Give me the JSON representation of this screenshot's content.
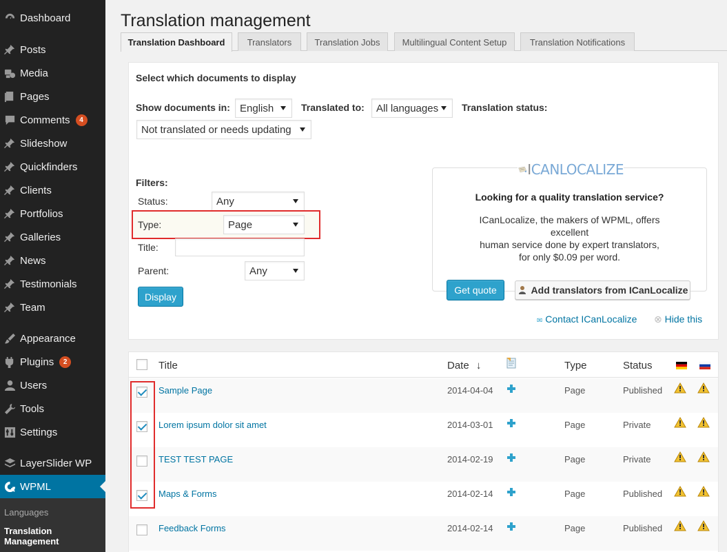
{
  "sidebar": {
    "items": [
      {
        "label": "Dashboard",
        "icon": "dashboard-icon"
      },
      {
        "label": "Posts",
        "icon": "pin-icon"
      },
      {
        "label": "Media",
        "icon": "media-icon"
      },
      {
        "label": "Pages",
        "icon": "pages-icon"
      },
      {
        "label": "Comments",
        "icon": "comments-icon",
        "badge": "4"
      },
      {
        "label": "Slideshow",
        "icon": "pin-icon"
      },
      {
        "label": "Quickfinders",
        "icon": "pin-icon"
      },
      {
        "label": "Clients",
        "icon": "pin-icon"
      },
      {
        "label": "Portfolios",
        "icon": "pin-icon"
      },
      {
        "label": "Galleries",
        "icon": "pin-icon"
      },
      {
        "label": "News",
        "icon": "pin-icon"
      },
      {
        "label": "Testimonials",
        "icon": "pin-icon"
      },
      {
        "label": "Team",
        "icon": "pin-icon"
      },
      {
        "label": "Appearance",
        "icon": "brush-icon"
      },
      {
        "label": "Plugins",
        "icon": "plugin-icon",
        "badge": "2"
      },
      {
        "label": "Users",
        "icon": "user-icon"
      },
      {
        "label": "Tools",
        "icon": "wrench-icon"
      },
      {
        "label": "Settings",
        "icon": "settings-icon"
      },
      {
        "label": "LayerSlider WP",
        "icon": "layers-icon"
      },
      {
        "label": "WPML",
        "icon": "wpml-icon",
        "active": true
      }
    ],
    "submenu": [
      "Languages",
      "Translation Management"
    ]
  },
  "page": {
    "title": "Translation management"
  },
  "tabs": [
    "Translation Dashboard",
    "Translators",
    "Translation Jobs",
    "Multilingual Content Setup",
    "Translation Notifications"
  ],
  "filters": {
    "heading": "Select which documents to display",
    "show_in_label": "Show documents in:",
    "show_in_value": "English",
    "translated_to_label": "Translated to:",
    "translated_to_value": "All languages",
    "status_label": "Translation status:",
    "status_value": "Not translated or needs updating",
    "filters_label": "Filters:",
    "status_filter_label": "Status:",
    "status_filter_value": "Any",
    "type_label": "Type:",
    "type_value": "Page",
    "title_label": "Title:",
    "title_value": "",
    "parent_label": "Parent:",
    "parent_value": "Any",
    "display_button": "Display"
  },
  "promo": {
    "logo_text": "ICANLOCALIZE",
    "headline": "Looking for a quality translation service?",
    "line1": "ICanLocalize, the makers of WPML, offers",
    "line2": "excellent",
    "line3": "human service done by expert translators,",
    "line4": "for only $0.09 per word.",
    "quote_button": "Get quote",
    "add_translators_button": "Add translators from ICanLocalize",
    "contact_link": "Contact ICanLocalize",
    "hide_link": "Hide this"
  },
  "table": {
    "columns": {
      "title": "Title",
      "date": "Date",
      "sort_indicator": "↓",
      "type": "Type",
      "status": "Status"
    },
    "language_flags": [
      "german-flag-icon",
      "russian-flag-icon"
    ],
    "rows": [
      {
        "title": "Sample Page",
        "date": "2014-04-04",
        "type": "Page",
        "status": "Published",
        "checked": true
      },
      {
        "title": "Lorem ipsum dolor sit amet",
        "date": "2014-03-01",
        "type": "Page",
        "status": "Private",
        "checked": true
      },
      {
        "title": "TEST TEST PAGE",
        "date": "2014-02-19",
        "type": "Page",
        "status": "Private",
        "checked": false
      },
      {
        "title": "Maps & Forms",
        "date": "2014-02-14",
        "type": "Page",
        "status": "Published",
        "checked": true
      },
      {
        "title": "Feedback Forms",
        "date": "2014-02-14",
        "type": "Page",
        "status": "Published",
        "checked": false
      }
    ]
  },
  "colors": {
    "sidebar_bg": "#222222",
    "accent": "#0074a2",
    "button_blue": "#2ea2cc",
    "highlight_red": "#e02b2b",
    "badge_orange": "#d54e21"
  }
}
